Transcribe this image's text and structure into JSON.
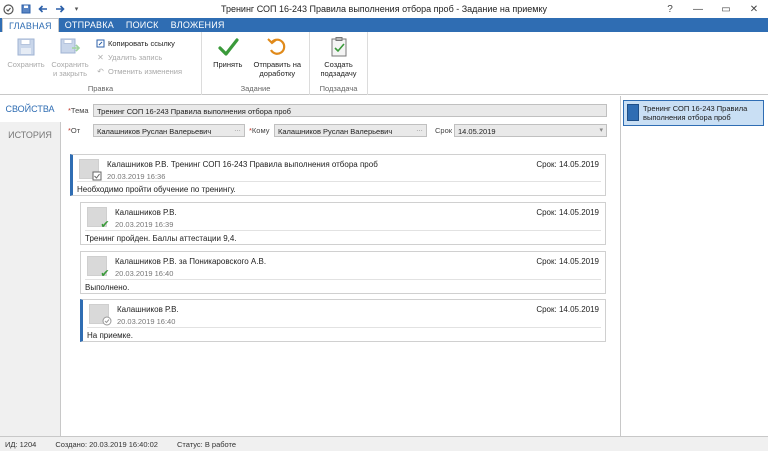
{
  "window": {
    "title": "Тренинг СОП 16-243 Правила выполнения отбора проб - Задание на приемку",
    "help": "?",
    "minimize": "—",
    "restore": "▭",
    "close": "✕"
  },
  "ribbon_tabs": [
    "ГЛАВНАЯ",
    "ОТПРАВКА",
    "ПОИСК",
    "ВЛОЖЕНИЯ"
  ],
  "ribbon": {
    "edit": {
      "save": "Сохранить",
      "save_close_1": "Сохранить",
      "save_close_2": "и закрыть",
      "copy_link": "Копировать ссылку",
      "delete": "Удалить запись",
      "cancel": "Отменить изменения",
      "label": "Правка"
    },
    "task": {
      "accept": "Принять",
      "rework_1": "Отправить на",
      "rework_2": "доработку",
      "label": "Задание"
    },
    "subtask": {
      "create_1": "Создать",
      "create_2": "подзадачу",
      "label": "Подзадача"
    }
  },
  "side_tabs": [
    "СВОЙСТВА",
    "ИСТОРИЯ"
  ],
  "form": {
    "subject_label": "Тема",
    "subject": "Тренинг СОП 16-243 Правила выполнения отбора проб",
    "from_label": "От",
    "from": "Калашников Руслан Валерьевич",
    "to_label": "Кому",
    "to": "Калашников Руслан Валерьевич",
    "due_label": "Срок",
    "due": "14.05.2019",
    "required_mark": "*"
  },
  "messages": [
    {
      "author": "Калашников Р.В.   Тренинг СОП 16-243 Правила выполнения отбора проб",
      "date": "20.03.2019 16:36",
      "due": "Срок: 14.05.2019",
      "body": "Необходимо пройти обучение по тренингу."
    },
    {
      "author": "Калашников Р.В.",
      "date": "20.03.2019 16:39",
      "due": "Срок: 14.05.2019",
      "body": "Тренинг пройден. Баллы аттестации 9,4."
    },
    {
      "author": "Калашников Р.В. за Поникаровского А.В.",
      "date": "20.03.2019 16:40",
      "due": "Срок: 14.05.2019",
      "body": "Выполнено."
    },
    {
      "author": "Калашников Р.В.",
      "date": "20.03.2019 16:40",
      "due": "Срок: 14.05.2019",
      "body": "На приемке."
    }
  ],
  "right_panel": {
    "item": "Тренинг СОП 16-243 Правила выполнения отбора проб"
  },
  "status": {
    "id": "ИД: 1204",
    "created": "Создано: 20.03.2019 16:40:02",
    "state": "Статус: В работе"
  },
  "colors": {
    "accent": "#2f6db3",
    "check": "#3a9a3a",
    "rework": "#e08a1a"
  }
}
